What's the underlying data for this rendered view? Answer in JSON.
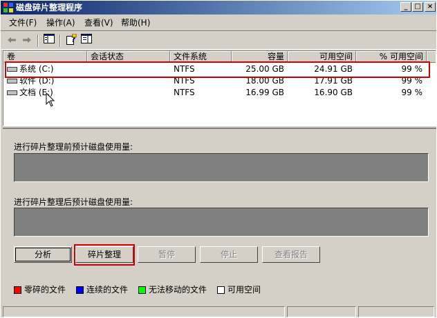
{
  "window": {
    "title": "磁盘碎片整理程序"
  },
  "titlebar_buttons": {
    "minimize": "_",
    "maximize": "□",
    "close": "×"
  },
  "menu": [
    {
      "label": "文件(F)"
    },
    {
      "label": "操作(A)"
    },
    {
      "label": "查看(V)"
    },
    {
      "label": "帮助(H)"
    }
  ],
  "toolbar": {
    "back_icon": "back-arrow-icon",
    "forward_icon": "forward-arrow-icon",
    "tree_icon": "show-hide-console-tree-icon",
    "help_icon": "help-icon",
    "properties_icon": "properties-icon"
  },
  "columns": [
    "卷",
    "会话状态",
    "文件系统",
    "容量",
    "可用空间",
    "% 可用空间"
  ],
  "volumes": [
    {
      "name": "系统 (C:)",
      "session": "",
      "fs": "NTFS",
      "capacity": "25.00 GB",
      "free": "24.91 GB",
      "pct_free": "99 %"
    },
    {
      "name": "软件 (D:)",
      "session": "",
      "fs": "NTFS",
      "capacity": "18.00 GB",
      "free": "17.91 GB",
      "pct_free": "99 %"
    },
    {
      "name": "文档 (E:)",
      "session": "",
      "fs": "NTFS",
      "capacity": "16.99 GB",
      "free": "16.90 GB",
      "pct_free": "99 %"
    }
  ],
  "panels": {
    "before_label": "进行碎片整理前预计磁盘使用量:",
    "after_label": "进行碎片整理后预计磁盘使用量:"
  },
  "buttons": {
    "analyze": "分析",
    "defragment": "碎片整理",
    "pause": "暂停",
    "stop": "停止",
    "view_report": "查看报告"
  },
  "legend": [
    {
      "label": "零碎的文件",
      "color": "#ff0000"
    },
    {
      "label": "连续的文件",
      "color": "#0000ff"
    },
    {
      "label": "无法移动的文件",
      "color": "#00ff00"
    },
    {
      "label": "可用空间",
      "color": "#ffffff"
    }
  ],
  "colors": {
    "highlight_box": "#d00000",
    "usage_bar": "#808080"
  }
}
